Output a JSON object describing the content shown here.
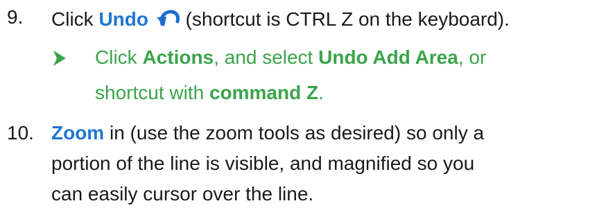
{
  "step9": {
    "number": "9.",
    "click": "Click ",
    "undo": "Undo",
    "rest": " (shortcut is CTRL Z on the keyboard).",
    "icon": "undo-arrow-icon",
    "sub": {
      "line1_a": "Click ",
      "line1_b": "Actions",
      "line1_c": ", and select ",
      "line1_d": "Undo Add Area",
      "line1_e": ", or",
      "line2_a": "shortcut with ",
      "line2_b": "command Z",
      "line2_c": "."
    }
  },
  "step10": {
    "number": "10.",
    "zoom": "Zoom",
    "line1": " in (use the zoom tools as desired) so only a",
    "line2": "portion of the line is visible, and magnified so you",
    "line3": "can easily cursor over the line."
  },
  "colors": {
    "accent_blue": "#1f77d0",
    "sub_green": "#3aa44a",
    "bullet_green": "#3aa44a"
  }
}
